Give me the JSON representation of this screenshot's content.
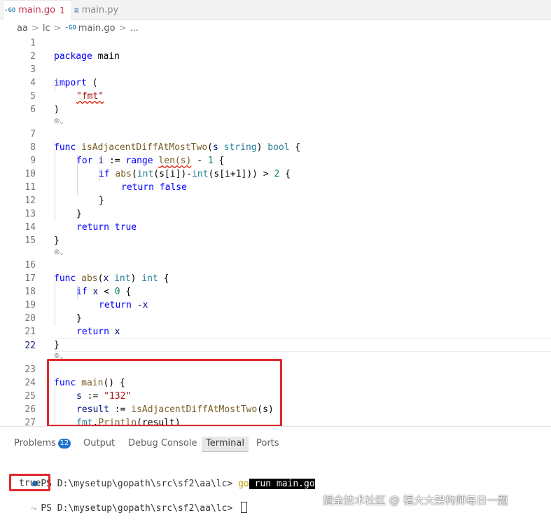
{
  "tabs": [
    {
      "icon": "-GO",
      "label": "main.go",
      "badge": "1"
    },
    {
      "icon": "≋",
      "label": "main.py"
    }
  ],
  "breadcrumb": {
    "seg1": "aa",
    "seg2": "lc",
    "icon": "-GO",
    "file": "main.go",
    "more": "..."
  },
  "code_lens": "⦾⌄",
  "line_numbers": [
    "1",
    "2",
    "3",
    "4",
    "5",
    "6",
    "7",
    "8",
    "9",
    "10",
    "11",
    "12",
    "13",
    "14",
    "15",
    "16",
    "17",
    "18",
    "19",
    "20",
    "21",
    "22",
    "23",
    "24",
    "25",
    "26",
    "27"
  ],
  "code": {
    "l1_kw": "package",
    "l1_name": "main",
    "l3_kw": "import",
    "l3_paren": " (",
    "l4_str": "\"fmt\"",
    "l5": ")",
    "l7_kw": "func",
    "l7_fn": "isAdjacentDiffAtMostTwo",
    "l7_p1": "(",
    "l7_param": "s",
    "l7_type": "string",
    "l7_p2": ")",
    "l7_ret": "bool",
    "l7_brace": "{",
    "l8_kw": "for",
    "l8_var": "i",
    "l8_op": ":=",
    "l8_range": "range",
    "l8_len": "len(s)",
    "l8_minus": "-",
    "l8_num": "1",
    "l8_brace": "{",
    "l9_kw": "if",
    "l9_abs": "abs",
    "l9_rest1": "(",
    "l9_int1": "int",
    "l9_rest2": "(s[i])-",
    "l9_int2": "int",
    "l9_rest3": "(s[i+1])) > ",
    "l9_num": "2",
    "l9_brace": " {",
    "l10_kw": "return",
    "l10_val": "false",
    "l11": "}",
    "l12": "}",
    "l13_kw": "return",
    "l13_val": "true",
    "l14": "}",
    "l16_kw": "func",
    "l16_fn": "abs",
    "l16_p1": "(",
    "l16_param": "x",
    "l16_type": "int",
    "l16_p2": ")",
    "l16_ret": "int",
    "l16_brace": "{",
    "l17_kw": "if",
    "l17_var": "x",
    "l17_op": "<",
    "l17_num": "0",
    "l17_brace": "{",
    "l18_kw": "return",
    "l18_val": "-x",
    "l19": "}",
    "l20_kw": "return",
    "l20_val": "x",
    "l21": "}",
    "l23_kw": "func",
    "l23_fn": "main",
    "l23_rest": "() {",
    "l24_var": "s",
    "l24_op": ":=",
    "l24_str": "\"132\"",
    "l25_var": "result",
    "l25_op": ":=",
    "l25_fn": "isAdjacentDiffAtMostTwo",
    "l25_rest": "(s)",
    "l26_pkg": "fmt",
    "l26_dot": ".",
    "l26_fn": "Println",
    "l26_rest": "(result)",
    "l27": "}"
  },
  "panel": {
    "tabs": {
      "problems": "Problems",
      "problems_count": "12",
      "output": "Output",
      "debug": "Debug Console",
      "terminal": "Terminal",
      "ports": "Ports"
    }
  },
  "terminal": {
    "prompt1": "PS D:\\mysetup\\gopath\\src\\sf2\\aa\\lc> ",
    "cmd_go": "go",
    "cmd_rest": " run main.go",
    "output": "true",
    "prompt2": "PS D:\\mysetup\\gopath\\src\\sf2\\aa\\lc> "
  },
  "watermark": "掘金技术社区 @ 福大大架构师每日一题"
}
